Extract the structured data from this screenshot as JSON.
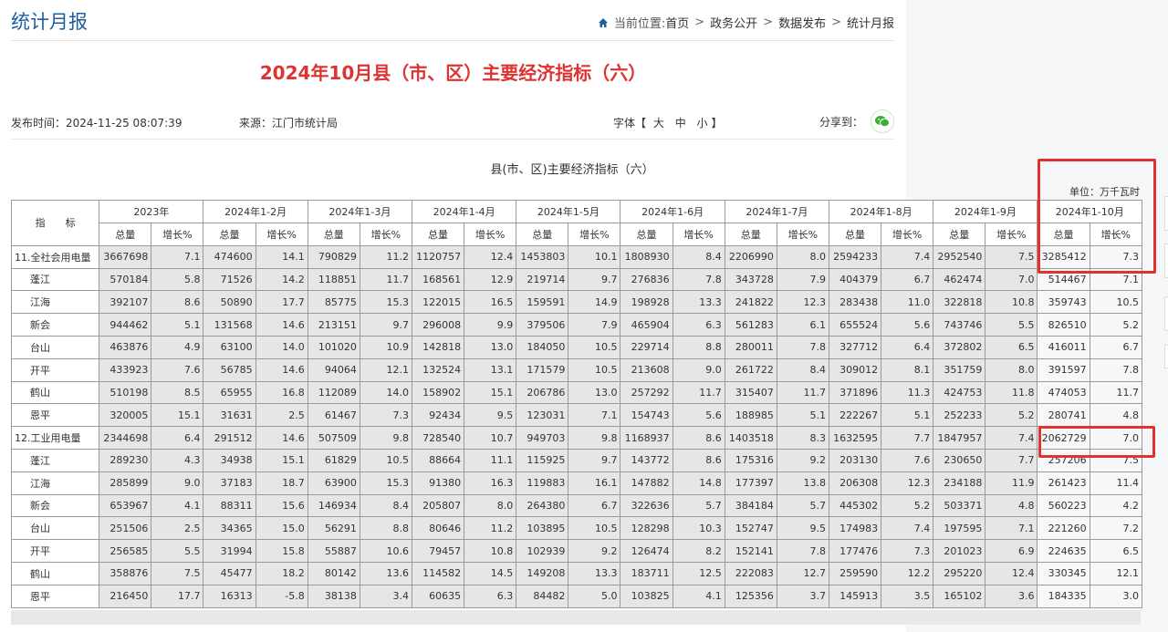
{
  "header": {
    "page_heading": "统计月报",
    "breadcrumb_prefix": "当前位置:",
    "crumbs": [
      "首页",
      "政务公开",
      "数据发布",
      "统计月报"
    ]
  },
  "article": {
    "title": "2024年10月县（市、区）主要经济指标（六）",
    "pub_label": "发布时间：2024-11-25 08:07:39",
    "source_label": "来源：江门市统计局",
    "font_label": "字体",
    "font_sizes": [
      "大",
      "中",
      "小"
    ],
    "share_label": "分享到："
  },
  "table": {
    "title": "县(市、区)主要经济指标（六）",
    "unit": "单位：万千瓦时",
    "indicator_header": "指　　标",
    "periods": [
      "2023年",
      "2024年1-2月",
      "2024年1-3月",
      "2024年1-4月",
      "2024年1-5月",
      "2024年1-6月",
      "2024年1-7月",
      "2024年1-8月",
      "2024年1-9月",
      "2024年1-10月"
    ],
    "sub_total": "总量",
    "sub_growth": "增长%",
    "rows": [
      {
        "label": "11.全社会用电量",
        "main": true,
        "values": [
          "3667698",
          "7.1",
          "474600",
          "14.1",
          "790829",
          "11.2",
          "1120757",
          "12.4",
          "1453803",
          "10.1",
          "1808930",
          "8.4",
          "2206990",
          "8.0",
          "2594233",
          "7.4",
          "2952540",
          "7.5",
          "3285412",
          "7.3"
        ]
      },
      {
        "label": "蓬江",
        "main": false,
        "values": [
          "570184",
          "5.8",
          "71526",
          "14.2",
          "118851",
          "11.7",
          "168561",
          "12.9",
          "219714",
          "9.7",
          "276836",
          "7.8",
          "343728",
          "7.9",
          "404379",
          "6.7",
          "462474",
          "7.0",
          "514467",
          "7.1"
        ]
      },
      {
        "label": "江海",
        "main": false,
        "values": [
          "392107",
          "8.6",
          "50890",
          "17.7",
          "85775",
          "15.3",
          "122015",
          "16.5",
          "159591",
          "14.9",
          "198928",
          "13.3",
          "241822",
          "12.3",
          "283438",
          "11.0",
          "322818",
          "10.8",
          "359743",
          "10.5"
        ]
      },
      {
        "label": "新会",
        "main": false,
        "values": [
          "944462",
          "5.1",
          "131568",
          "14.6",
          "213151",
          "9.7",
          "296008",
          "9.9",
          "379506",
          "7.9",
          "465904",
          "6.3",
          "561283",
          "6.1",
          "655524",
          "5.6",
          "743746",
          "5.5",
          "826510",
          "5.2"
        ]
      },
      {
        "label": "台山",
        "main": false,
        "values": [
          "463876",
          "4.9",
          "63100",
          "14.0",
          "101020",
          "10.9",
          "142818",
          "13.0",
          "184050",
          "10.5",
          "229714",
          "8.8",
          "280011",
          "7.8",
          "327712",
          "6.4",
          "372802",
          "6.5",
          "416011",
          "6.7"
        ]
      },
      {
        "label": "开平",
        "main": false,
        "values": [
          "433923",
          "7.6",
          "56785",
          "14.6",
          "94064",
          "12.1",
          "132524",
          "13.1",
          "171579",
          "10.5",
          "213608",
          "9.0",
          "261722",
          "8.4",
          "309012",
          "8.1",
          "351759",
          "8.0",
          "391597",
          "7.8"
        ]
      },
      {
        "label": "鹤山",
        "main": false,
        "values": [
          "510198",
          "8.5",
          "65955",
          "16.8",
          "112089",
          "14.0",
          "158902",
          "15.1",
          "206786",
          "13.0",
          "257292",
          "11.7",
          "315407",
          "11.7",
          "371896",
          "11.3",
          "424753",
          "11.8",
          "474053",
          "11.7"
        ]
      },
      {
        "label": "恩平",
        "main": false,
        "values": [
          "320005",
          "15.1",
          "31631",
          "2.5",
          "61467",
          "7.3",
          "92434",
          "9.5",
          "123031",
          "7.1",
          "154743",
          "5.6",
          "188985",
          "5.1",
          "222267",
          "5.1",
          "252233",
          "5.2",
          "280741",
          "4.8"
        ]
      },
      {
        "label": "12.工业用电量",
        "main": true,
        "values": [
          "2344698",
          "6.4",
          "291512",
          "14.6",
          "507509",
          "9.8",
          "728540",
          "10.7",
          "949703",
          "9.8",
          "1168937",
          "8.6",
          "1403518",
          "8.3",
          "1632595",
          "7.7",
          "1847957",
          "7.4",
          "2062729",
          "7.0"
        ]
      },
      {
        "label": "蓬江",
        "main": false,
        "values": [
          "289230",
          "4.3",
          "34938",
          "15.1",
          "61829",
          "10.5",
          "88664",
          "11.1",
          "115925",
          "9.7",
          "143772",
          "8.6",
          "175316",
          "9.2",
          "203130",
          "7.6",
          "230650",
          "7.7",
          "257206",
          "7.5"
        ]
      },
      {
        "label": "江海",
        "main": false,
        "values": [
          "285899",
          "9.0",
          "37183",
          "18.7",
          "63900",
          "15.3",
          "91380",
          "16.3",
          "119883",
          "16.1",
          "147882",
          "14.8",
          "177397",
          "13.8",
          "206308",
          "12.3",
          "234188",
          "11.9",
          "261423",
          "11.4"
        ]
      },
      {
        "label": "新会",
        "main": false,
        "values": [
          "653967",
          "4.1",
          "88311",
          "15.6",
          "146934",
          "8.4",
          "205807",
          "8.0",
          "264380",
          "6.7",
          "322636",
          "5.7",
          "384184",
          "5.7",
          "445302",
          "5.2",
          "503371",
          "4.8",
          "560223",
          "4.2"
        ]
      },
      {
        "label": "台山",
        "main": false,
        "values": [
          "251506",
          "2.5",
          "34365",
          "15.0",
          "56291",
          "8.8",
          "80646",
          "11.2",
          "103895",
          "10.5",
          "128298",
          "10.3",
          "152747",
          "9.5",
          "174983",
          "7.4",
          "197595",
          "7.1",
          "221260",
          "7.2"
        ]
      },
      {
        "label": "开平",
        "main": false,
        "values": [
          "256585",
          "5.5",
          "31994",
          "15.8",
          "55887",
          "10.6",
          "79457",
          "10.8",
          "102939",
          "9.2",
          "126474",
          "8.2",
          "152141",
          "7.8",
          "177476",
          "7.3",
          "201023",
          "6.9",
          "224635",
          "6.5"
        ]
      },
      {
        "label": "鹤山",
        "main": false,
        "values": [
          "358876",
          "7.5",
          "45477",
          "18.2",
          "80142",
          "13.6",
          "114582",
          "14.5",
          "149208",
          "13.3",
          "183711",
          "12.5",
          "222083",
          "12.7",
          "259590",
          "12.2",
          "295220",
          "12.4",
          "330345",
          "12.1"
        ]
      },
      {
        "label": "恩平",
        "main": false,
        "values": [
          "216450",
          "17.7",
          "16313",
          "-5.8",
          "38138",
          "3.4",
          "60635",
          "6.3",
          "84482",
          "5.0",
          "103825",
          "4.1",
          "125356",
          "3.7",
          "145913",
          "3.5",
          "165102",
          "3.6",
          "184335",
          "3.0"
        ]
      }
    ]
  },
  "colors": {
    "heading_blue": "#1f5f9e",
    "title_red": "#d33333",
    "highlight_red": "#e1322e",
    "shade_gray": "#e6e6e6",
    "wechat_green": "#3cb034"
  }
}
